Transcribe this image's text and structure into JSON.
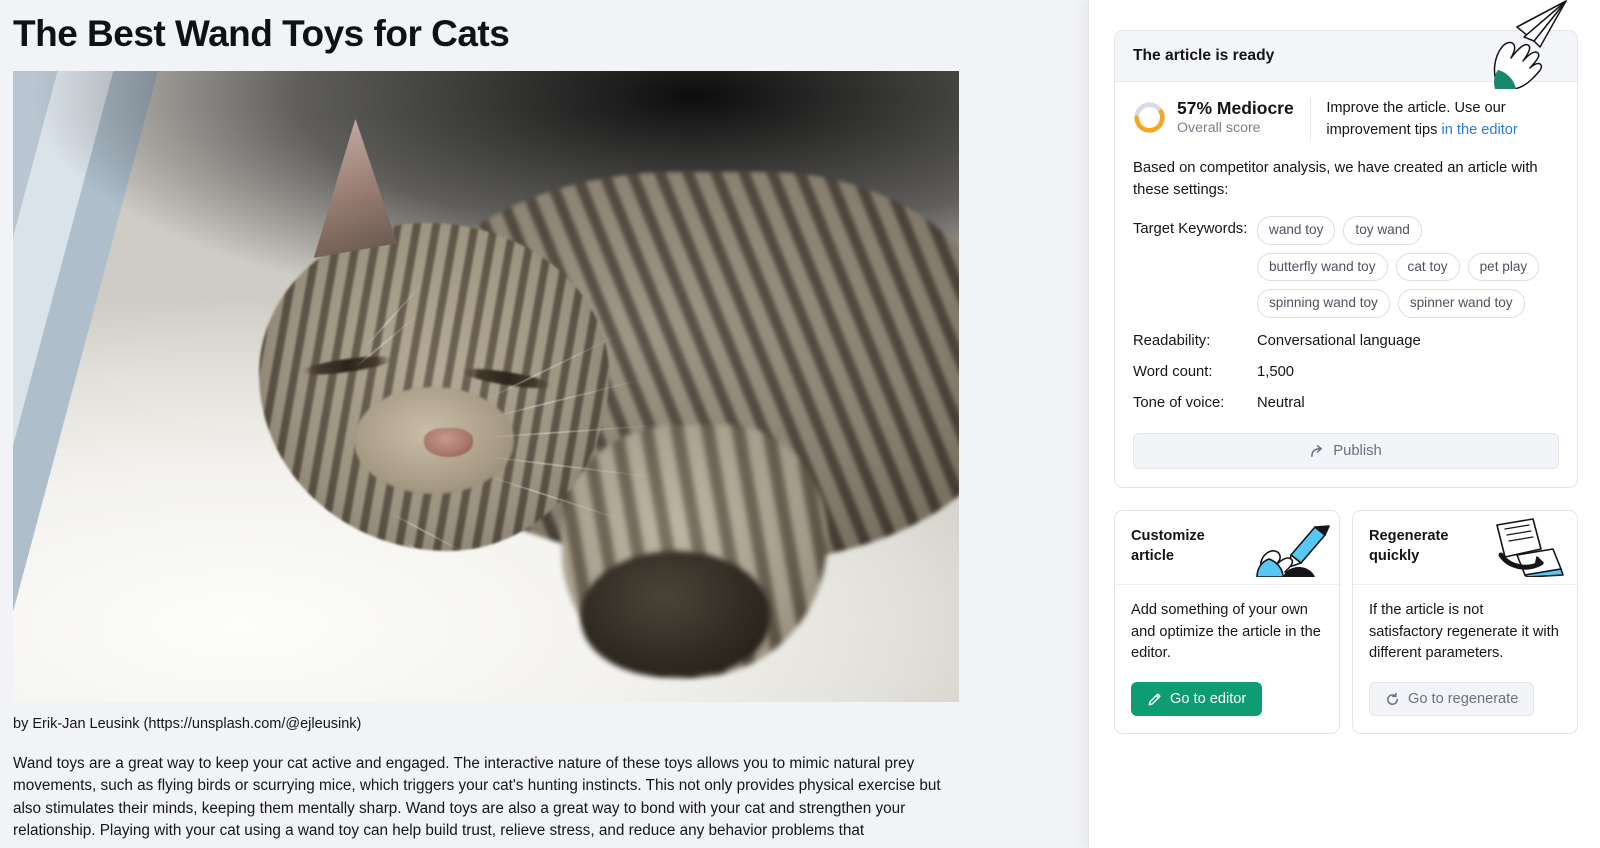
{
  "article": {
    "title": "The Best Wand Toys for Cats",
    "image_caption": "by Erik-Jan Leusink (https://unsplash.com/@ejleusink)",
    "image_alt": "sleeping tabby cat on a white fluffy blanket",
    "body": "Wand toys are a great way to keep your cat active and engaged. The interactive nature of these toys allows you to mimic natural prey movements, such as flying birds or scurrying mice, which triggers your cat's hunting instincts. This not only provides physical exercise but also stimulates their minds, keeping them mentally sharp. Wand toys are also a great way to bond with your cat and strengthen your relationship. Playing with your cat using a wand toy can help build trust, relieve stress, and reduce any behavior problems that"
  },
  "panel": {
    "header_title": "The article is ready",
    "score": {
      "percent": 57,
      "percent_label": "57% Mediocre",
      "sub_label": "Overall score",
      "arc_color": "#f5a623",
      "track_color": "#d9dbe2"
    },
    "improve": {
      "text_before": "Improve the article. Use our improvement tips ",
      "link_text": "in the editor",
      "link_color": "#2b7cd3"
    },
    "intro": "Based on competitor analysis, we have created an article with these settings:",
    "keywords_label": "Target Keywords:",
    "keywords": [
      "wand toy",
      "toy wand",
      "butterfly wand toy",
      "cat toy",
      "pet play",
      "spinning wand toy",
      "spinner wand toy"
    ],
    "settings": [
      {
        "key": "Readability:",
        "value": "Conversational language"
      },
      {
        "key": "Word count:",
        "value": "1,500"
      },
      {
        "key": "Tone of voice:",
        "value": "Neutral"
      }
    ],
    "publish_label": "Publish",
    "publish_icon": "share-arrow-icon"
  },
  "cards": [
    {
      "title": "Customize article",
      "text": "Add something of your own and optimize the article in the editor.",
      "button_label": "Go to editor",
      "button_icon": "pencil-icon",
      "button_color": "#0e9c72",
      "illustration": "hand-holding-pen-icon"
    },
    {
      "title": "Regenerate quickly",
      "text": "If the article is not satisfactory regenerate it with different parameters.",
      "button_label": "Go to regenerate",
      "button_icon": "refresh-icon",
      "button_color": "#f3f4f8",
      "illustration": "documents-refresh-icon"
    }
  ],
  "theme": {
    "page_bg": "#f2f3f7",
    "panel_bg": "#ffffff",
    "accent_green": "#0e9c72",
    "accent_blue": "#2b7cd3",
    "accent_orange": "#f5a623",
    "illustration_blue": "#55c8f5"
  }
}
